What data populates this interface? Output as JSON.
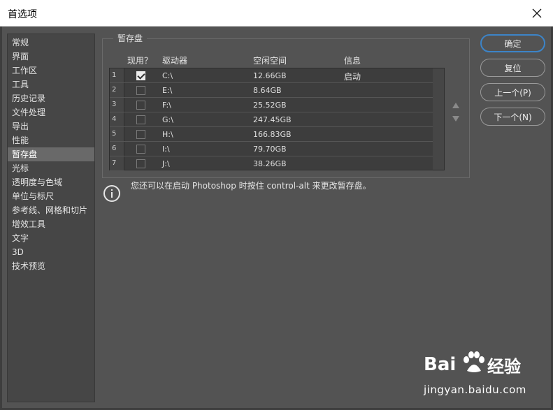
{
  "window": {
    "title": "首选项"
  },
  "sidebar": {
    "items": [
      {
        "label": "常规",
        "active": false
      },
      {
        "label": "界面",
        "active": false
      },
      {
        "label": "工作区",
        "active": false
      },
      {
        "label": "工具",
        "active": false
      },
      {
        "label": "历史记录",
        "active": false
      },
      {
        "label": "文件处理",
        "active": false
      },
      {
        "label": "导出",
        "active": false
      },
      {
        "label": "性能",
        "active": false
      },
      {
        "label": "暂存盘",
        "active": true
      },
      {
        "label": "光标",
        "active": false
      },
      {
        "label": "透明度与色域",
        "active": false
      },
      {
        "label": "单位与标尺",
        "active": false
      },
      {
        "label": "参考线、网格和切片",
        "active": false
      },
      {
        "label": "增效工具",
        "active": false
      },
      {
        "label": "文字",
        "active": false
      },
      {
        "label": "3D",
        "active": false
      },
      {
        "label": "技术预览",
        "active": false
      }
    ]
  },
  "scratch": {
    "group_title": "暂存盘",
    "columns": {
      "active": "现用？",
      "drive": "驱动器",
      "free": "空闲空间",
      "info": "信息"
    },
    "rows": [
      {
        "n": "1",
        "checked": true,
        "drive": "C:\\",
        "free": "12.66GB",
        "info": "启动"
      },
      {
        "n": "2",
        "checked": false,
        "drive": "E:\\",
        "free": "8.64GB",
        "info": ""
      },
      {
        "n": "3",
        "checked": false,
        "drive": "F:\\",
        "free": "25.52GB",
        "info": ""
      },
      {
        "n": "4",
        "checked": false,
        "drive": "G:\\",
        "free": "247.45GB",
        "info": ""
      },
      {
        "n": "5",
        "checked": false,
        "drive": "H:\\",
        "free": "166.83GB",
        "info": ""
      },
      {
        "n": "6",
        "checked": false,
        "drive": "I:\\",
        "free": "79.70GB",
        "info": ""
      },
      {
        "n": "7",
        "checked": false,
        "drive": "J:\\",
        "free": "38.26GB",
        "info": ""
      }
    ],
    "note": "您还可以在启动 Photoshop 时按住 control-alt 来更改暂存盘。"
  },
  "buttons": {
    "ok": "确定",
    "reset": "复位",
    "prev": "上一个(P)",
    "next": "下一个(N)"
  },
  "icons": {
    "close": "close-icon",
    "up": "arrow-up-icon",
    "down": "arrow-down-icon",
    "info": "info-icon"
  },
  "colors": {
    "accent": "#3c84c8",
    "panel": "#535353",
    "selected": "#696969"
  },
  "watermark": {
    "logo_latin": "Bai",
    "logo_cn": "经验",
    "url": "jingyan.baidu.com"
  }
}
